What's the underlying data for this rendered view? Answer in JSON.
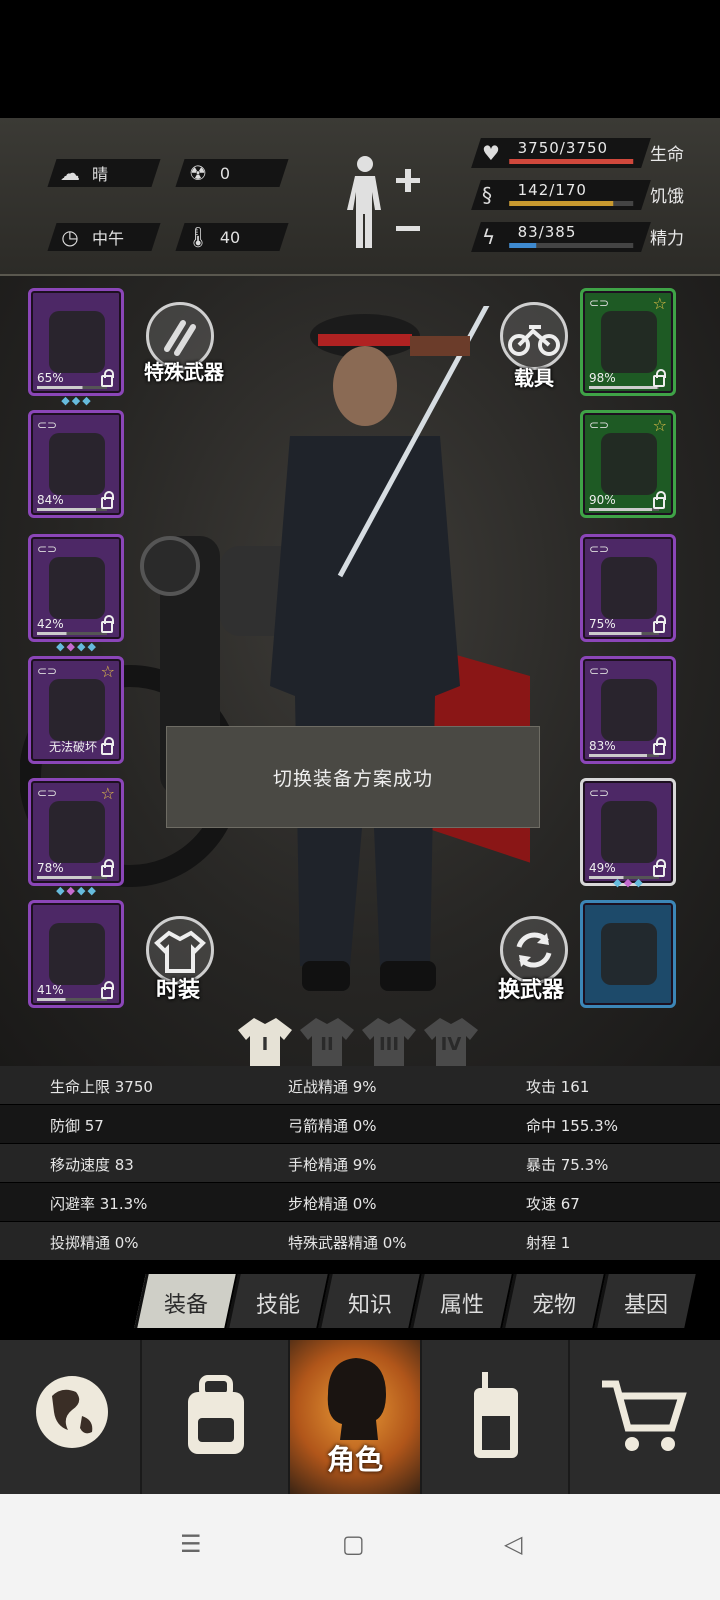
{
  "hud": {
    "weather": "晴",
    "radiation": "0",
    "time_of_day": "中午",
    "temperature": "40",
    "health": {
      "value": "3750/3750",
      "label": "生命",
      "fraction": 1.0,
      "color": "#d0483c"
    },
    "hunger": {
      "value": "142/170",
      "label": "饥饿",
      "fraction": 0.835,
      "color": "#c8992f"
    },
    "energy": {
      "value": "83/385",
      "label": "精力",
      "fraction": 0.216,
      "color": "#3e8ad0"
    }
  },
  "left_slots": [
    {
      "pct": "65%",
      "gems": 3,
      "star": false,
      "link": false
    },
    {
      "pct": "84%",
      "gems": 0,
      "star": false,
      "link": true
    },
    {
      "pct": "42%",
      "gems": 4,
      "star": false,
      "link": true
    },
    {
      "note": "无法破坏",
      "gems": 0,
      "star": true,
      "link": true
    },
    {
      "pct": "78%",
      "gems": 4,
      "star": true,
      "link": true
    },
    {
      "pct": "41%",
      "gems": 0,
      "star": false,
      "link": false
    }
  ],
  "right_slots": [
    {
      "pct": "98%",
      "color": "green",
      "star": true,
      "link": true
    },
    {
      "pct": "90%",
      "color": "green",
      "star": true,
      "link": true
    },
    {
      "pct": "75%",
      "color": "purple",
      "star": false,
      "link": true
    },
    {
      "pct": "83%",
      "color": "purple",
      "star": false,
      "link": true
    },
    {
      "pct": "49%",
      "color": "purple",
      "star": false,
      "link": true,
      "selected": true
    },
    {
      "color": "blue"
    }
  ],
  "buttons": {
    "special_weapon": "特殊武器",
    "vehicle": "载具",
    "fashion": "时装",
    "swap_weapon": "换武器"
  },
  "toast": "切换装备方案成功",
  "outfits": [
    "I",
    "II",
    "III",
    "IV"
  ],
  "stats": [
    [
      "生命上限 3750",
      "近战精通 9%",
      "攻击 161"
    ],
    [
      "防御 57",
      "弓箭精通 0%",
      "命中 155.3%"
    ],
    [
      "移动速度 83",
      "手枪精通 9%",
      "暴击 75.3%"
    ],
    [
      "闪避率 31.3%",
      "步枪精通 0%",
      "攻速 67"
    ],
    [
      "投掷精通 0%",
      "特殊武器精通 0%",
      "射程 1"
    ]
  ],
  "tabs": [
    "装备",
    "技能",
    "知识",
    "属性",
    "宠物",
    "基因"
  ],
  "nav": {
    "active_label": "角色"
  }
}
